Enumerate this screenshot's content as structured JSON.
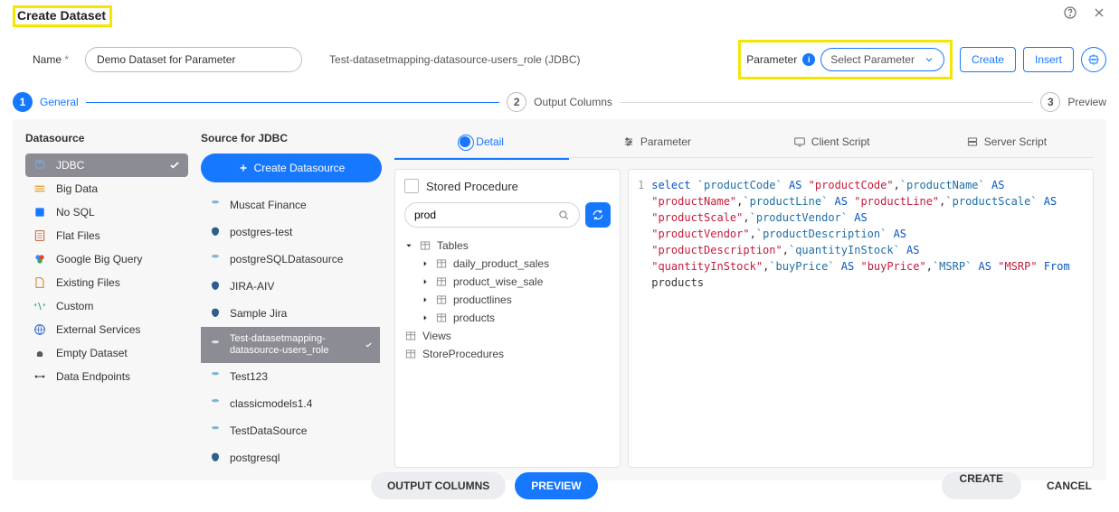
{
  "header": {
    "title": "Create Dataset"
  },
  "config": {
    "nameLabel": "Name",
    "nameReq": "*",
    "nameValue": "Demo Dataset for Parameter",
    "dsString": "Test-datasetmapping-datasource-users_role (JDBC)",
    "paramLabel": "Parameter",
    "paramPlaceholder": "Select Parameter",
    "createBtn": "Create",
    "insertBtn": "Insert"
  },
  "steps": {
    "s1": {
      "num": "1",
      "label": "General"
    },
    "s2": {
      "num": "2",
      "label": "Output Columns"
    },
    "s3": {
      "num": "3",
      "label": "Preview"
    }
  },
  "dsCol": {
    "heading": "Datasource",
    "items": [
      {
        "label": "JDBC",
        "selected": true
      },
      {
        "label": "Big Data"
      },
      {
        "label": "No SQL"
      },
      {
        "label": "Flat Files"
      },
      {
        "label": "Google Big Query"
      },
      {
        "label": "Existing Files"
      },
      {
        "label": "Custom"
      },
      {
        "label": "External Services"
      },
      {
        "label": "Empty Dataset"
      },
      {
        "label": "Data Endpoints"
      }
    ]
  },
  "srcCol": {
    "heading": "Source for JDBC",
    "createBtn": "Create Datasource",
    "items": [
      {
        "label": "Muscat Finance"
      },
      {
        "label": "postgres-test"
      },
      {
        "label": "postgreSQLDatasource"
      },
      {
        "label": "JIRA-AIV"
      },
      {
        "label": "Sample Jira"
      },
      {
        "label": "Test-datasetmapping-datasource-users_role",
        "selected": true
      },
      {
        "label": "Test123"
      },
      {
        "label": "classicmodels1.4"
      },
      {
        "label": "TestDataSource"
      },
      {
        "label": "postgresql"
      }
    ]
  },
  "tabs": {
    "t1": "Detail",
    "t2": "Parameter",
    "t3": "Client Script",
    "t4": "Server Script"
  },
  "leftPane": {
    "storedProc": "Stored Procedure",
    "searchValue": "prod",
    "tree": {
      "tables": "Tables",
      "n1": "daily_product_sales",
      "n2": "product_wise_sale",
      "n3": "productlines",
      "n4": "products",
      "views": "Views",
      "storeProc": "StoreProcedures"
    }
  },
  "sql": {
    "lineNum": "1",
    "tokens": {
      "select": "select",
      "as": "AS",
      "from": "From",
      "pc": "`productCode`",
      "pcA": "\"productCode\"",
      "pn": "`productName`",
      "pnA": "\"productName\"",
      "pl": "`productLine`",
      "plA": "\"productLine\"",
      "ps": "`productScale`",
      "psA": "\"productScale\"",
      "pv": "`productVendor`",
      "pvA": "\"productVendor\"",
      "pd": "`productDescription`",
      "pdA": "\"productDescription\"",
      "qs": "`quantityInStock`",
      "qsA": "\"quantityInStock\"",
      "bp": "`buyPrice`",
      "bpA": "\"buyPrice\"",
      "ms": "`MSRP`",
      "msA": "\"MSRP\"",
      "tbl": "products"
    }
  },
  "footer": {
    "outputCols": "OUTPUT COLUMNS",
    "preview": "PREVIEW",
    "create": "CREATE",
    "cancel": "CANCEL"
  }
}
